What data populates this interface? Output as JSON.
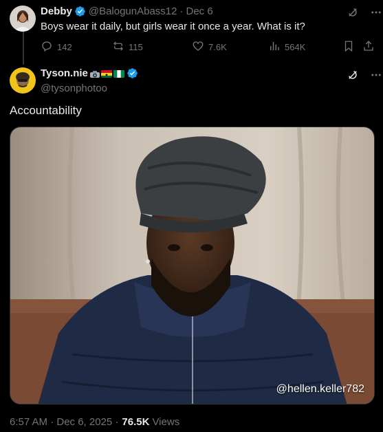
{
  "parent_tweet": {
    "author_name": "Debby",
    "author_handle": "@BalogunAbass12",
    "separator": "·",
    "date": "Dec 6",
    "text": "Boys wear it daily, but girls wear it once a year. What is it?",
    "actions": {
      "replies": "142",
      "retweets": "115",
      "likes": "7.6K",
      "views": "564K"
    }
  },
  "reply_tweet": {
    "author_name": "Tyson.nie",
    "author_handle": "@tysonphotoo",
    "text": "Accountability",
    "media_watermark": "@hellen.keller782",
    "timestamp": "6:57 AM · Dec 6, 2025 ·",
    "views_count": "76.5K",
    "views_label": "Views"
  },
  "colors": {
    "background": "#000000",
    "primary_text": "#e7e9ea",
    "secondary_text": "#71767b",
    "verified_blue": "#1d9bf0",
    "divider": "#2f3336"
  },
  "icons": [
    "verified-badge-icon",
    "grok-icon",
    "more-icon",
    "reply-icon",
    "retweet-icon",
    "like-icon",
    "views-icon",
    "bookmark-icon",
    "share-icon",
    "camera-emoji-icon",
    "ghana-flag-icon",
    "nigeria-flag-icon"
  ]
}
